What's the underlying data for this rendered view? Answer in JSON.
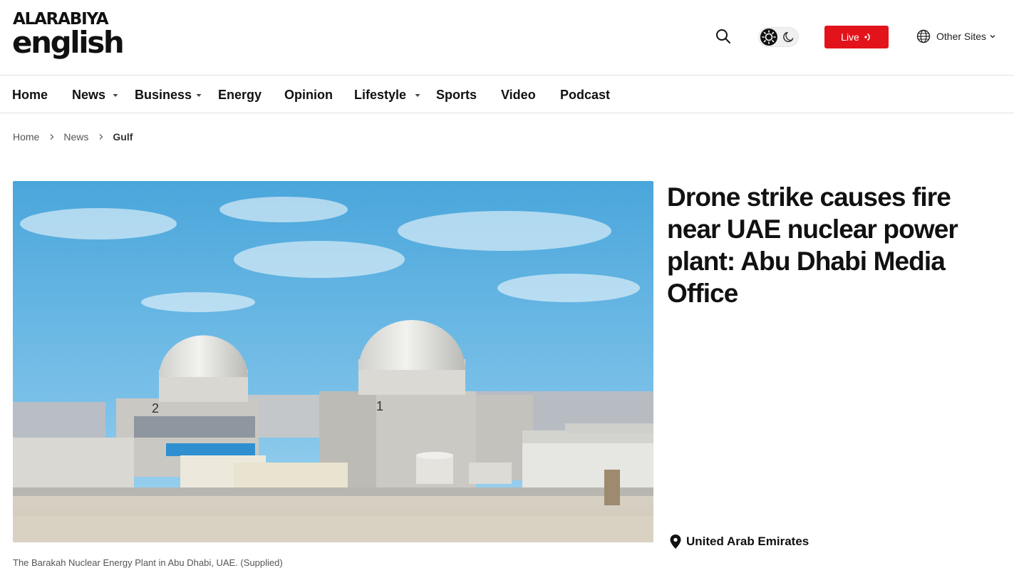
{
  "header": {
    "logo_top": "ALARABIYA",
    "logo_bottom": "english",
    "live_label": "Live",
    "other_sites_label": "Other Sites"
  },
  "nav": {
    "items": [
      {
        "label": "Home",
        "has_dropdown": false
      },
      {
        "label": "News",
        "has_dropdown": true
      },
      {
        "label": "Business",
        "has_dropdown": true
      },
      {
        "label": "Energy",
        "has_dropdown": false
      },
      {
        "label": "Opinion",
        "has_dropdown": false
      },
      {
        "label": "Lifestyle",
        "has_dropdown": true
      },
      {
        "label": "Sports",
        "has_dropdown": false
      },
      {
        "label": "Video",
        "has_dropdown": false
      },
      {
        "label": "Podcast",
        "has_dropdown": false
      }
    ]
  },
  "breadcrumb": {
    "items": [
      "Home",
      "News"
    ],
    "current": "Gulf"
  },
  "article": {
    "headline": "Drone strike causes fire near UAE nuclear power plant: Abu Dhabi Media Office",
    "image_caption": "The Barakah Nuclear Energy Plant in Abu Dhabi, UAE. (Supplied)",
    "location": "United Arab Emirates",
    "image_unit_labels": [
      "2",
      "1"
    ]
  },
  "colors": {
    "live_red": "#e3131b",
    "text": "#111111",
    "sky": "#5fb3df"
  },
  "icons": {
    "search": "search-icon",
    "theme_light": "sun-icon",
    "theme_dark": "moon-icon",
    "live": "live-broadcast-icon",
    "globe": "globe-icon",
    "location": "location-pin-icon"
  }
}
